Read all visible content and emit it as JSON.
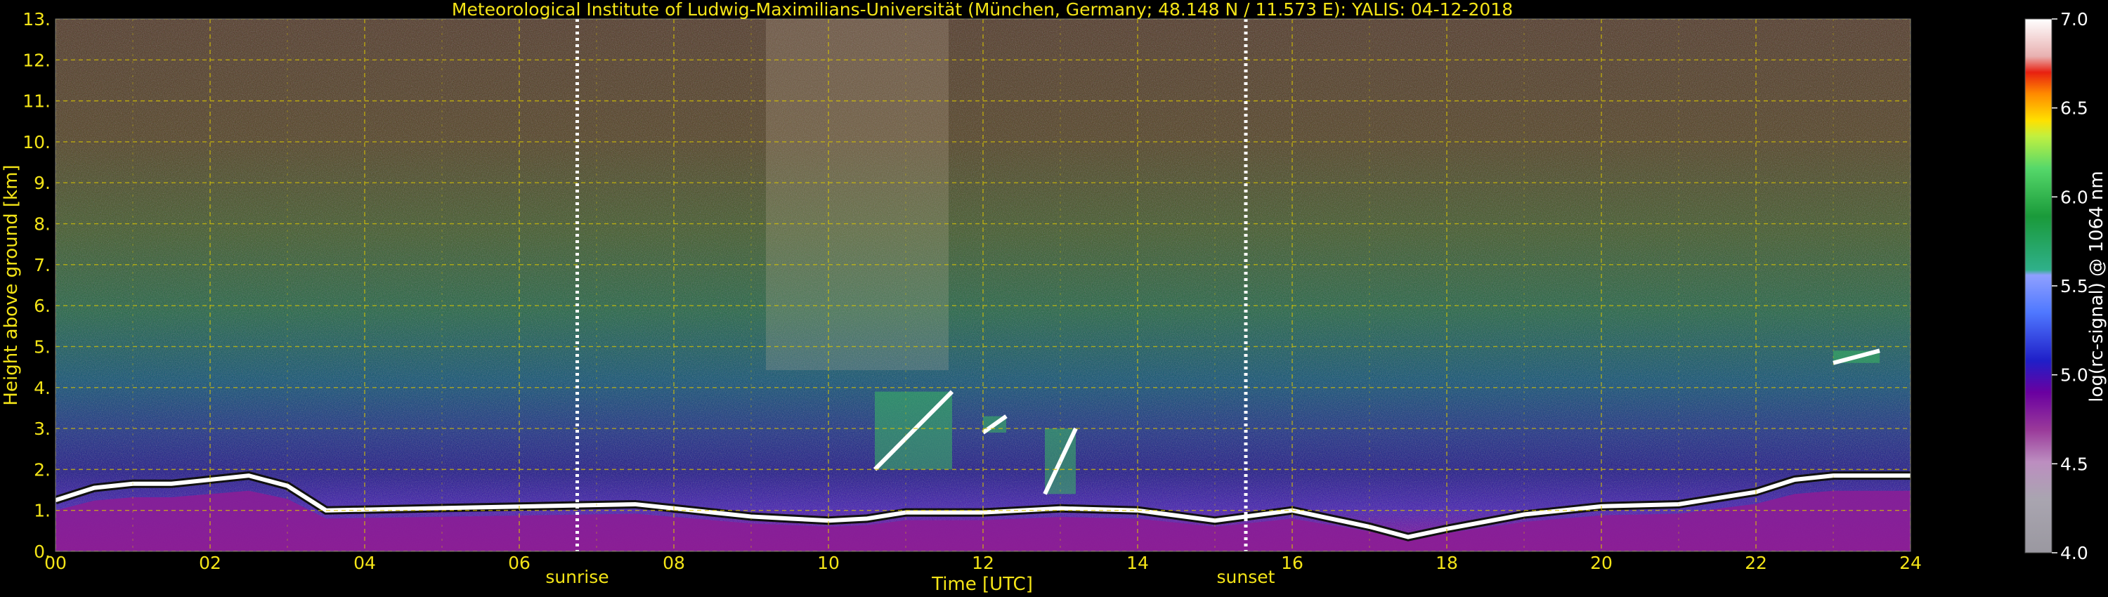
{
  "chart_data": {
    "type": "heatmap",
    "title": "Meteorological Institute of Ludwig-Maximilians-Universität (München, Germany; 48.148 N / 11.573 E):    YALIS: 04-12-2018",
    "xlabel": "Time [UTC]",
    "ylabel": "Height above ground [km]",
    "x_range": [
      0,
      24
    ],
    "y_range": [
      0,
      13
    ],
    "x_ticks": [
      "00",
      "02",
      "04",
      "06",
      "08",
      "10",
      "12",
      "14",
      "16",
      "18",
      "20",
      "22",
      "24"
    ],
    "y_ticks": [
      "0.",
      "1.",
      "2.",
      "3.",
      "4.",
      "5.",
      "6.",
      "7.",
      "8.",
      "9.",
      "10.",
      "11.",
      "12.",
      "13."
    ],
    "grid": true,
    "markers": [
      {
        "label": "sunrise",
        "time_utc": 6.75
      },
      {
        "label": "sunset",
        "time_utc": 15.4
      }
    ],
    "colorbar": {
      "label": "log(rc-signal) @ 1064 nm",
      "range": [
        4.0,
        7.0
      ],
      "ticks": [
        "4.0",
        "4.5",
        "5.0",
        "5.5",
        "6.0",
        "6.5",
        "7.0"
      ]
    },
    "boundary_layer_top_km": [
      [
        0.0,
        1.25
      ],
      [
        0.5,
        1.55
      ],
      [
        1.0,
        1.65
      ],
      [
        1.5,
        1.65
      ],
      [
        2.0,
        1.75
      ],
      [
        2.5,
        1.85
      ],
      [
        3.0,
        1.6
      ],
      [
        3.5,
        1.0
      ],
      [
        7.5,
        1.15
      ],
      [
        8.0,
        1.05
      ],
      [
        8.5,
        0.95
      ],
      [
        9.0,
        0.85
      ],
      [
        9.5,
        0.8
      ],
      [
        10.0,
        0.75
      ],
      [
        10.5,
        0.8
      ],
      [
        11.0,
        0.95
      ],
      [
        12.0,
        0.95
      ],
      [
        13.0,
        1.05
      ],
      [
        14.0,
        1.0
      ],
      [
        15.0,
        0.75
      ],
      [
        16.0,
        1.0
      ],
      [
        17.0,
        0.6
      ],
      [
        17.5,
        0.35
      ],
      [
        18.0,
        0.55
      ],
      [
        19.0,
        0.9
      ],
      [
        20.0,
        1.1
      ],
      [
        21.0,
        1.15
      ],
      [
        22.0,
        1.45
      ],
      [
        22.5,
        1.75
      ],
      [
        23.0,
        1.85
      ],
      [
        24.0,
        1.85
      ]
    ],
    "elevated_clouds": [
      {
        "time_start": 10.6,
        "time_end": 11.6,
        "height_bottom_km": 2.0,
        "height_top_km": 3.9
      },
      {
        "time_start": 12.0,
        "time_end": 12.3,
        "height_bottom_km": 2.9,
        "height_top_km": 3.3
      },
      {
        "time_start": 12.8,
        "time_end": 13.2,
        "height_bottom_km": 1.4,
        "height_top_km": 3.0
      },
      {
        "time_start": 23.0,
        "time_end": 23.6,
        "height_bottom_km": 4.6,
        "height_top_km": 4.9
      }
    ]
  }
}
